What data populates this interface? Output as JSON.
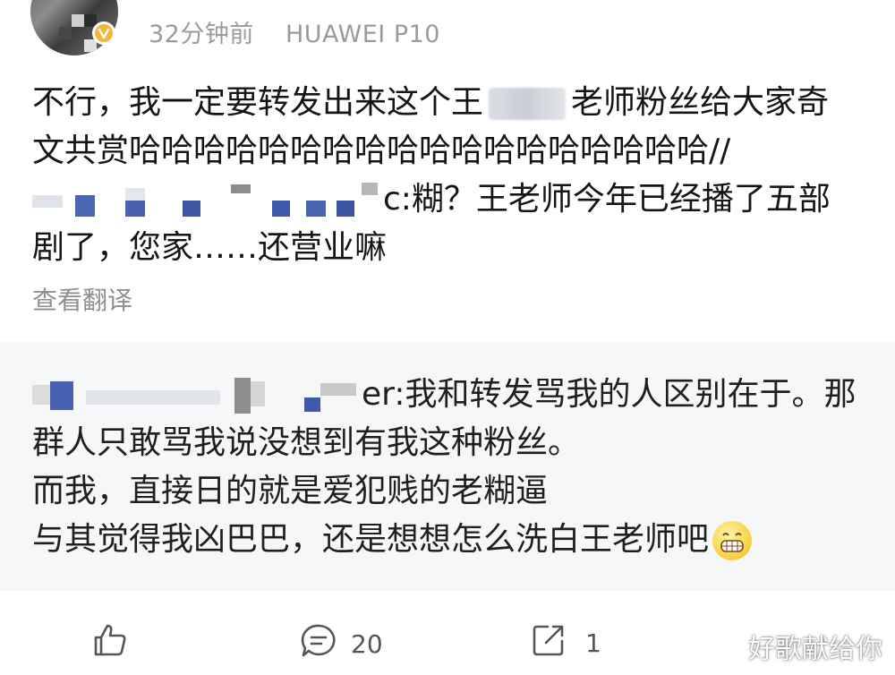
{
  "post": {
    "time": "32分钟前",
    "device": "HUAWEI P10",
    "lines": [
      {
        "pre": "不行，我一定要转发出来这个王",
        "post": "老师粉丝给大家奇"
      },
      {
        "text": "文共赏哈哈哈哈哈哈哈哈哈哈哈哈哈哈哈哈哈哈//"
      },
      {
        "tail": "c:糊？王老师今年已经播了五部"
      },
      {
        "text": "剧了，您家……还营业嘛"
      }
    ],
    "translate_label": "查看翻译"
  },
  "quote": {
    "line1_tail": "er:我和转发骂我的人区别在于。那",
    "line2": "群人只敢骂我说没想到有我这种粉丝。",
    "line3": "而我，直接日的就是爱犯贱的老糊逼",
    "line4": "与其觉得我凶巴巴，还是想想怎么洗白王老师吧"
  },
  "actions": {
    "like_icon": "thumbs-up-icon",
    "comment_icon": "comment-icon",
    "comment_count": "20",
    "share_icon": "share-icon",
    "share_count": "1"
  },
  "watermark": "好歌献给你",
  "colors": {
    "quote_bg": "#f6f7f9",
    "meta_gray": "#9b9b9b",
    "badge_gold": "#f3b63a"
  }
}
